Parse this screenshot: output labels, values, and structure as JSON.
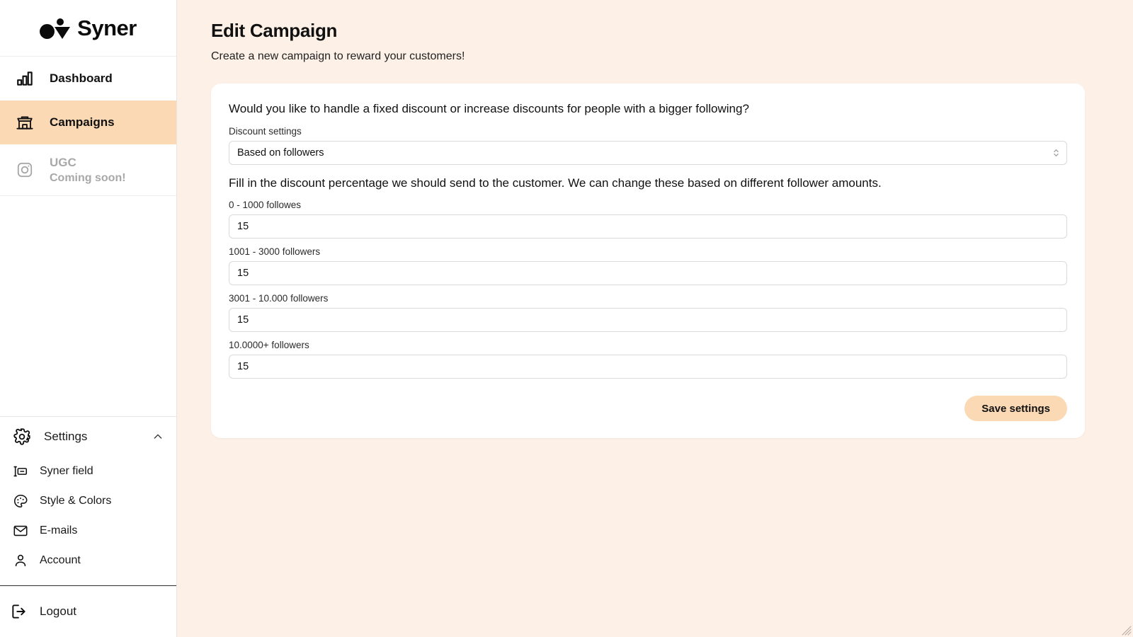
{
  "brand": {
    "name": "Syner",
    "accent": "#FBD9B4",
    "background": "#FDF1E7"
  },
  "sidebar": {
    "main_items": [
      {
        "label": "Dashboard",
        "icon": "bar-chart-icon",
        "active": false
      },
      {
        "label": "Campaigns",
        "icon": "storefront-icon",
        "active": true
      },
      {
        "label": "UGC",
        "sublabel": "Coming soon!",
        "icon": "camera-icon",
        "disabled": true
      }
    ],
    "settings": {
      "label": "Settings",
      "icon": "gear-icon",
      "chevron": "chevron-up-icon",
      "expanded": true,
      "items": [
        {
          "label": "Syner field",
          "icon": "text-field-icon"
        },
        {
          "label": "Style & Colors",
          "icon": "palette-icon"
        },
        {
          "label": "E-mails",
          "icon": "envelope-icon"
        },
        {
          "label": "Account",
          "icon": "person-icon"
        }
      ]
    },
    "logout": {
      "label": "Logout",
      "icon": "logout-icon"
    }
  },
  "header": {
    "title": "Edit Campaign",
    "subtitle": "Create a new campaign to reward your customers!"
  },
  "card": {
    "question": "Would you like to handle a fixed discount or increase discounts for people with a bigger following?",
    "discount_settings_label": "Discount settings",
    "discount_settings_value": "Based on followers",
    "description": "Fill in the discount percentage we should send to the customer. We can change these based on different follower amounts.",
    "tiers": [
      {
        "label": "0 - 1000 followes",
        "value": "15"
      },
      {
        "label": "1001 - 3000 followers",
        "value": "15"
      },
      {
        "label": "3001 - 10.000 followers",
        "value": "15"
      },
      {
        "label": "10.0000+ followers",
        "value": "15"
      }
    ],
    "save_label": "Save settings"
  }
}
